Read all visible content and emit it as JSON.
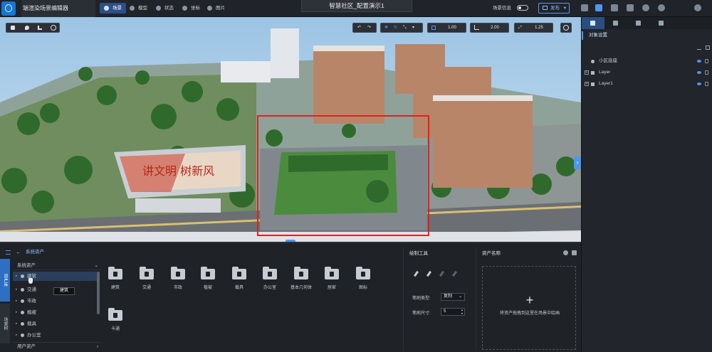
{
  "app": {
    "title": "端渲染场景编辑器",
    "doc_title": "智慧社区_配置演示1",
    "accent": "#4f97ec"
  },
  "topbar": {
    "tabs": [
      {
        "label": "场景",
        "icon": "scene-icon",
        "active": true
      },
      {
        "label": "模型",
        "icon": "model-icon",
        "active": false
      },
      {
        "label": "状态",
        "icon": "state-icon",
        "active": false
      },
      {
        "label": "坐标",
        "icon": "coordinate-icon",
        "active": false
      },
      {
        "label": "图片",
        "icon": "image-icon",
        "active": false
      }
    ],
    "scene_info_label": "场景信息",
    "publish_label": "发布",
    "right_icons": [
      "copy-icon",
      "save-icon",
      "preview-icon",
      "layers-icon",
      "help-icon",
      "user-icon",
      "settings-icon"
    ]
  },
  "viewport": {
    "left_icons": [
      "cube-icon",
      "marker-icon",
      "chart-icon",
      "globe-icon"
    ],
    "tools": [
      "undo-icon",
      "redo-icon",
      "move-icon",
      "rotate-icon",
      "scale-icon"
    ],
    "grid_value": "1.00",
    "angle_value": "2.00",
    "scale_value": "1.25",
    "selection_color": "#e02020",
    "billboard_text": "讲文明 树新风"
  },
  "right_panel": {
    "tabs": [
      "object-settings-icon",
      "location-icon",
      "wrench-icon",
      "image-icon"
    ],
    "section_title": "对象设置",
    "tree": [
      {
        "label": "小区底座",
        "expandable": false
      },
      {
        "label": "Layer",
        "expandable": true
      },
      {
        "label": "Layer1",
        "expandable": true
      }
    ]
  },
  "bottom_panel": {
    "vertical_tabs": [
      {
        "label": "资产库",
        "active": true
      },
      {
        "label": "场景树",
        "active": false
      }
    ],
    "header": "系统资产",
    "system_select": "系统资产",
    "tree_items": [
      "建筑",
      "交通",
      "市政",
      "植被",
      "载具",
      "办公室"
    ],
    "tooltip": "建筑",
    "user_assets": "用户资产",
    "folders": [
      "建筑",
      "交通",
      "市政",
      "植被",
      "载具",
      "办公室",
      "基本几何体",
      "居家",
      "图标",
      "卡通"
    ],
    "draw_tools": {
      "title": "绘制工具",
      "brush_type_label": "笔刷类型:",
      "brush_type_value": "复制",
      "brush_size_label": "笔刷尺寸:",
      "brush_size_value": "5"
    },
    "asset_name": {
      "title": "资产名称",
      "drop_hint": "将资产拖拽到这里在场景中绘画"
    }
  }
}
